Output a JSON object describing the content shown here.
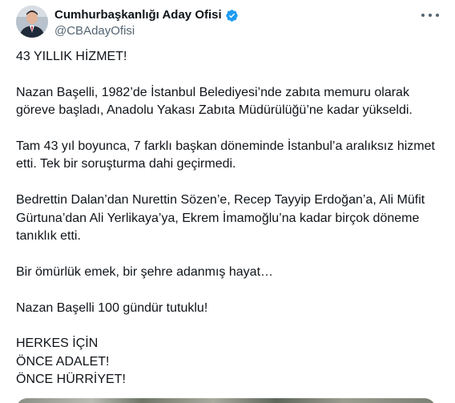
{
  "author": {
    "display_name": "Cumhurbaşkanlığı Aday Ofisi",
    "handle": "@CBAdayOfisi",
    "verified": true,
    "avatar_icon": "profile-photo",
    "verified_color": "#1d9bf0"
  },
  "more_icon": "more-horizontal-icon",
  "tweet": {
    "paragraphs": [
      "43 YILLIK HİZMET!",
      "Nazan Başelli, 1982’de İstanbul Belediyesi’nde zabıta memuru olarak göreve başladı, Anadolu Yakası Zabıta Müdürülüğü’ne kadar yükseldi.",
      "Tam 43 yıl boyunca, 7 farklı başkan döneminde İstanbul’a aralıksız hizmet etti. Tek bir soruşturma dahi geçirmedi.",
      "Bedrettin Dalan’dan Nurettin Sözen’e, Recep Tayyip Erdoğan’a, Ali Müfit Gürtuna’dan Ali Yerlikaya’ya, Ekrem İmamoğlu’na kadar birçok döneme tanıklık etti.",
      "Bir ömürlük emek, bir şehre adanmış hayat…",
      "Nazan Başelli 100 gündür tutuklu!",
      "HERKES İÇİN\nÖNCE ADALET!\nÖNCE HÜRRİYET!"
    ]
  },
  "colors": {
    "text": "#0f1419",
    "secondary": "#536471"
  }
}
